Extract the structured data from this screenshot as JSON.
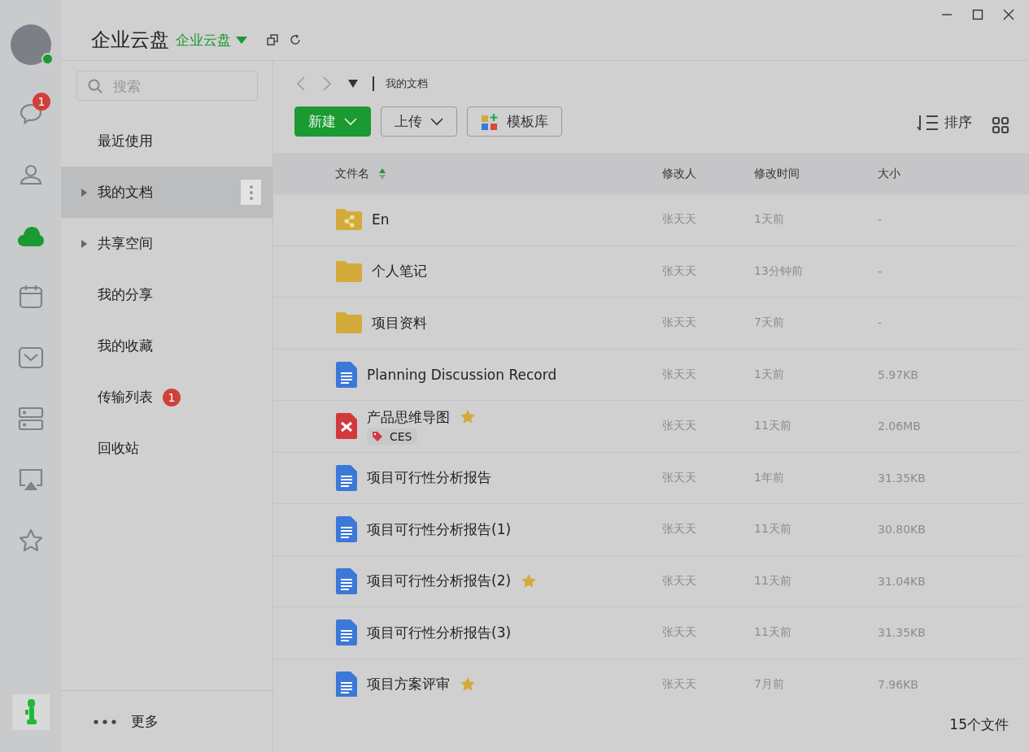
{
  "rail": {
    "online": true,
    "items": [
      {
        "kind": "chat",
        "badge": "1",
        "selected": false
      },
      {
        "kind": "contacts",
        "selected": false
      },
      {
        "kind": "cloud",
        "selected": true
      },
      {
        "kind": "calendar",
        "selected": false
      },
      {
        "kind": "mail",
        "selected": false
      },
      {
        "kind": "server",
        "selected": false
      },
      {
        "kind": "screen",
        "selected": false
      },
      {
        "kind": "star",
        "selected": false
      }
    ]
  },
  "app": {
    "title": "企业云盘",
    "space": "企业云盘"
  },
  "sidebar": {
    "search": {
      "placeholder": "搜索"
    },
    "items": [
      {
        "label": "最近使用",
        "expandable": false,
        "selected": false
      },
      {
        "label": "我的文档",
        "expandable": true,
        "selected": true
      },
      {
        "label": "共享空间",
        "expandable": true,
        "selected": false
      },
      {
        "label": "我的分享",
        "expandable": false,
        "selected": false
      },
      {
        "label": "我的收藏",
        "expandable": false,
        "selected": false
      },
      {
        "label": "传输列表",
        "expandable": false,
        "selected": false,
        "badge": "1"
      },
      {
        "label": "回收站",
        "expandable": false,
        "selected": false
      }
    ],
    "more": "更多"
  },
  "breadcrumb": "我的文档",
  "toolbar": {
    "new": "新建",
    "upload": "上传",
    "templates": "模板库",
    "sort": "排序"
  },
  "table": {
    "columns": [
      "文件名",
      "修改人",
      "修改时间",
      "大小"
    ],
    "rows": [
      {
        "kind": "shared-folder",
        "name": "En",
        "starred": false,
        "modifier": "张天天",
        "time": "1天前",
        "size": "-"
      },
      {
        "kind": "folder",
        "name": "个人笔记",
        "starred": false,
        "modifier": "张天天",
        "time": "13分钟前",
        "size": "-"
      },
      {
        "kind": "folder",
        "name": "项目资料",
        "starred": false,
        "modifier": "张天天",
        "time": "7天前",
        "size": "-"
      },
      {
        "kind": "doc",
        "name": "Planning Discussion Record",
        "starred": false,
        "modifier": "张天天",
        "time": "1天前",
        "size": "5.97KB"
      },
      {
        "kind": "mindmap",
        "name": "产品思维导图",
        "starred": true,
        "tag": "CES",
        "modifier": "张天天",
        "time": "11天前",
        "size": "2.06MB"
      },
      {
        "kind": "doc",
        "name": "项目可行性分析报告",
        "starred": false,
        "modifier": "张天天",
        "time": "1年前",
        "size": "31.35KB"
      },
      {
        "kind": "doc",
        "name": "项目可行性分析报告(1)",
        "starred": false,
        "modifier": "张天天",
        "time": "11天前",
        "size": "30.80KB"
      },
      {
        "kind": "doc",
        "name": "项目可行性分析报告(2)",
        "starred": true,
        "modifier": "张天天",
        "time": "11天前",
        "size": "31.04KB"
      },
      {
        "kind": "doc",
        "name": "项目可行性分析报告(3)",
        "starred": false,
        "modifier": "张天天",
        "time": "11天前",
        "size": "31.35KB"
      },
      {
        "kind": "doc",
        "name": "项目方案评审",
        "starred": true,
        "modifier": "张天天",
        "time": "7月前",
        "size": "7.96KB"
      }
    ]
  },
  "status": "15个文件"
}
